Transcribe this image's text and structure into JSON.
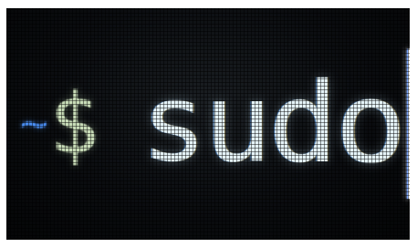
{
  "terminal": {
    "cwd_bracket": "]",
    "cwd": "~",
    "prompt_symbol": "$",
    "command": "sudo",
    "colors": {
      "background": "#0b0d10",
      "cwd": "#4a8ff5",
      "prompt": "#c8dcb8",
      "command": "#e4f2f6"
    }
  }
}
